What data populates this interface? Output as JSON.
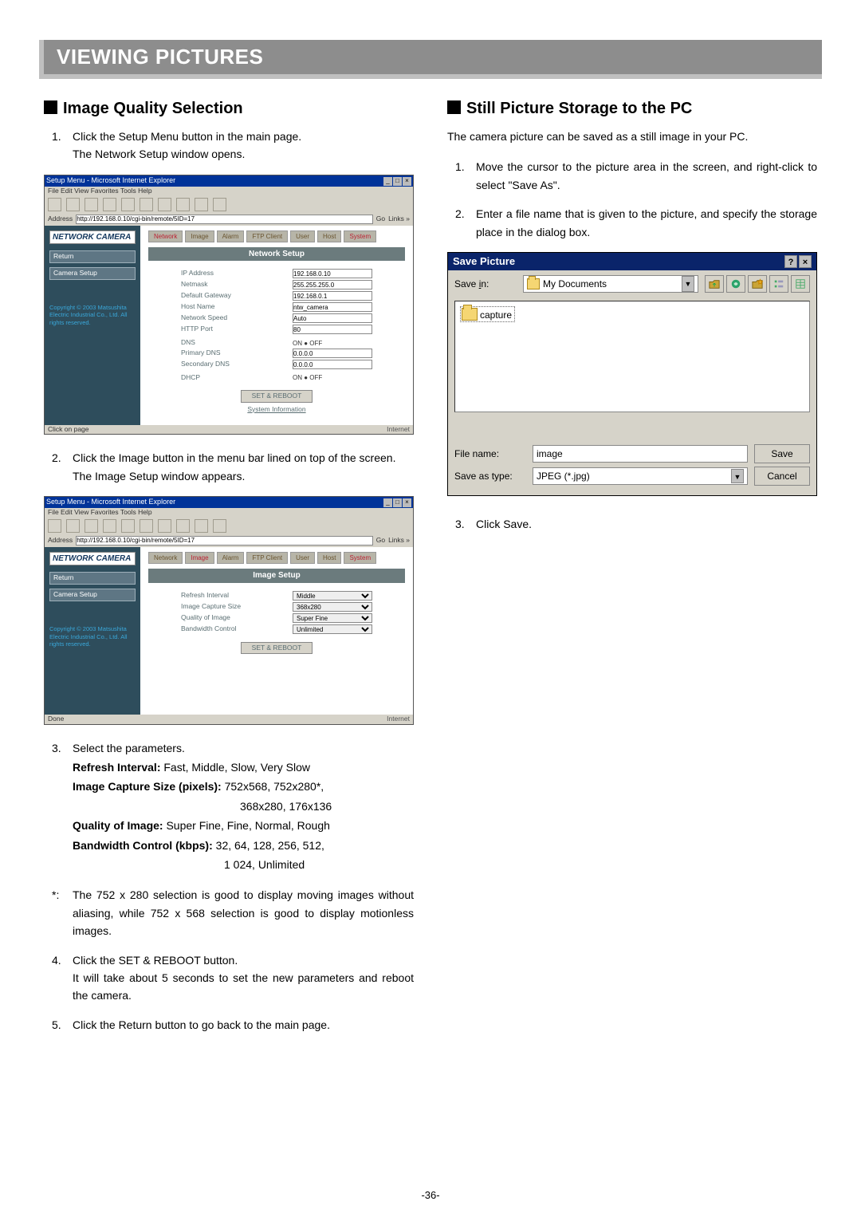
{
  "header": "VIEWING PICTURES",
  "left": {
    "title": "Image Quality Selection",
    "step1_num": "1.",
    "step1_a": "Click the Setup Menu button in the main page.",
    "step1_b": "The Network Setup window opens.",
    "step2_num": "2.",
    "step2_a": "Click the Image button in the menu bar lined on top of the screen.",
    "step2_b": "The Image Setup window appears.",
    "step3_num": "3.",
    "step3_a": "Select the parameters.",
    "p_refresh_l": "Refresh Interval: ",
    "p_refresh_v": "Fast, Middle, Slow, Very Slow",
    "p_size_l": "Image Capture Size (pixels): ",
    "p_size_v1": "752x568, 752x280*,",
    "p_size_v2": "368x280, 176x136",
    "p_quality_l": "Quality of Image: ",
    "p_quality_v": "Super Fine, Fine, Normal, Rough",
    "p_bw_l": "Bandwidth Control (kbps): ",
    "p_bw_v1": "32, 64, 128, 256, 512,",
    "p_bw_v2": "1 024, Unlimited",
    "star_num": "*:",
    "star": "The 752 x 280 selection is good to display moving images without aliasing, while 752 x 568 selection is good to display motionless images.",
    "step4_num": "4.",
    "step4_a": "Click the SET & REBOOT button.",
    "step4_b": "It will take about 5 seconds to set the new parameters and reboot the camera.",
    "step5_num": "5.",
    "step5": "Click the Return button to go back to the main page.",
    "ie1": {
      "title": "Setup Menu - Microsoft Internet Explorer",
      "menu": "File   Edit   View   Favorites   Tools   Help",
      "addr_label": "Address",
      "addr": "http://192.168.0.10/cgi-bin/remote/5ID=17",
      "go": "Go",
      "links": "Links »",
      "logo": "NETWORK CAMERA",
      "side_return": "Return",
      "side_camera": "Camera Setup",
      "copy": "Copyright © 2003 Matsushita Electric Industrial Co., Ltd. All rights reserved.",
      "tabs": [
        "Network",
        "Image",
        "Alarm",
        "FTP Client",
        "User",
        "Host",
        "System"
      ],
      "heading": "Network Setup",
      "rows": {
        "ip_l": "IP Address",
        "ip_v": "192.168.0.10",
        "nm_l": "Netmask",
        "nm_v": "255.255.255.0",
        "gw_l": "Default Gateway",
        "gw_v": "192.168.0.1",
        "hn_l": "Host Name",
        "hn_v": "ntw_camera",
        "ns_l": "Network Speed",
        "ns_v": "Auto",
        "hp_l": "HTTP Port",
        "hp_v": "80",
        "dns_l": "DNS",
        "dns_v": "ON  ●  OFF",
        "pd_l": "Primary DNS",
        "pd_v": "0.0.0.0",
        "sd_l": "Secondary DNS",
        "sd_v": "0.0.0.0",
        "dh_l": "DHCP",
        "dh_v": "ON  ●  OFF"
      },
      "setbtn": "SET & REBOOT",
      "sysinfo": "System Information",
      "status_l": "Click on page",
      "status_r": "Internet"
    },
    "ie2": {
      "title": "Setup Menu - Microsoft Internet Explorer",
      "heading": "Image Setup",
      "rows": {
        "ri_l": "Refresh Interval",
        "ri_v": "Middle",
        "ic_l": "Image Capture Size",
        "ic_v": "368x280",
        "qi_l": "Quality of Image",
        "qi_v": "Super Fine",
        "bc_l": "Bandwidth Control",
        "bc_v": "Unlimited"
      },
      "setbtn": "SET & REBOOT",
      "status_l": "Done",
      "status_r": "Internet"
    }
  },
  "right": {
    "title": "Still Picture Storage to the PC",
    "intro": "The camera picture can be saved as a still image in your PC.",
    "step1_num": "1.",
    "step1": "Move the cursor to the picture area in the screen, and right-click to select \"Save As\".",
    "step2_num": "2.",
    "step2": "Enter a file name that is given to the picture, and specify the storage place in the dialog box.",
    "step3_num": "3.",
    "step3": "Click Save.",
    "dlg": {
      "title": "Save Picture",
      "savein_l": "Save ",
      "savein_u": "i",
      "savein_r": "n:",
      "savein_folder": "My Documents",
      "file_item": "capture",
      "filename_l1": "File ",
      "filename_u": "n",
      "filename_l2": "ame:",
      "filename_v": "image",
      "savetype_l1": "Save as ",
      "savetype_u": "t",
      "savetype_l2": "ype:",
      "savetype_v": "JPEG (*.jpg)",
      "btn_save_u": "S",
      "btn_save_r": "ave",
      "btn_cancel": "Cancel"
    }
  },
  "pagenum": "-36-"
}
